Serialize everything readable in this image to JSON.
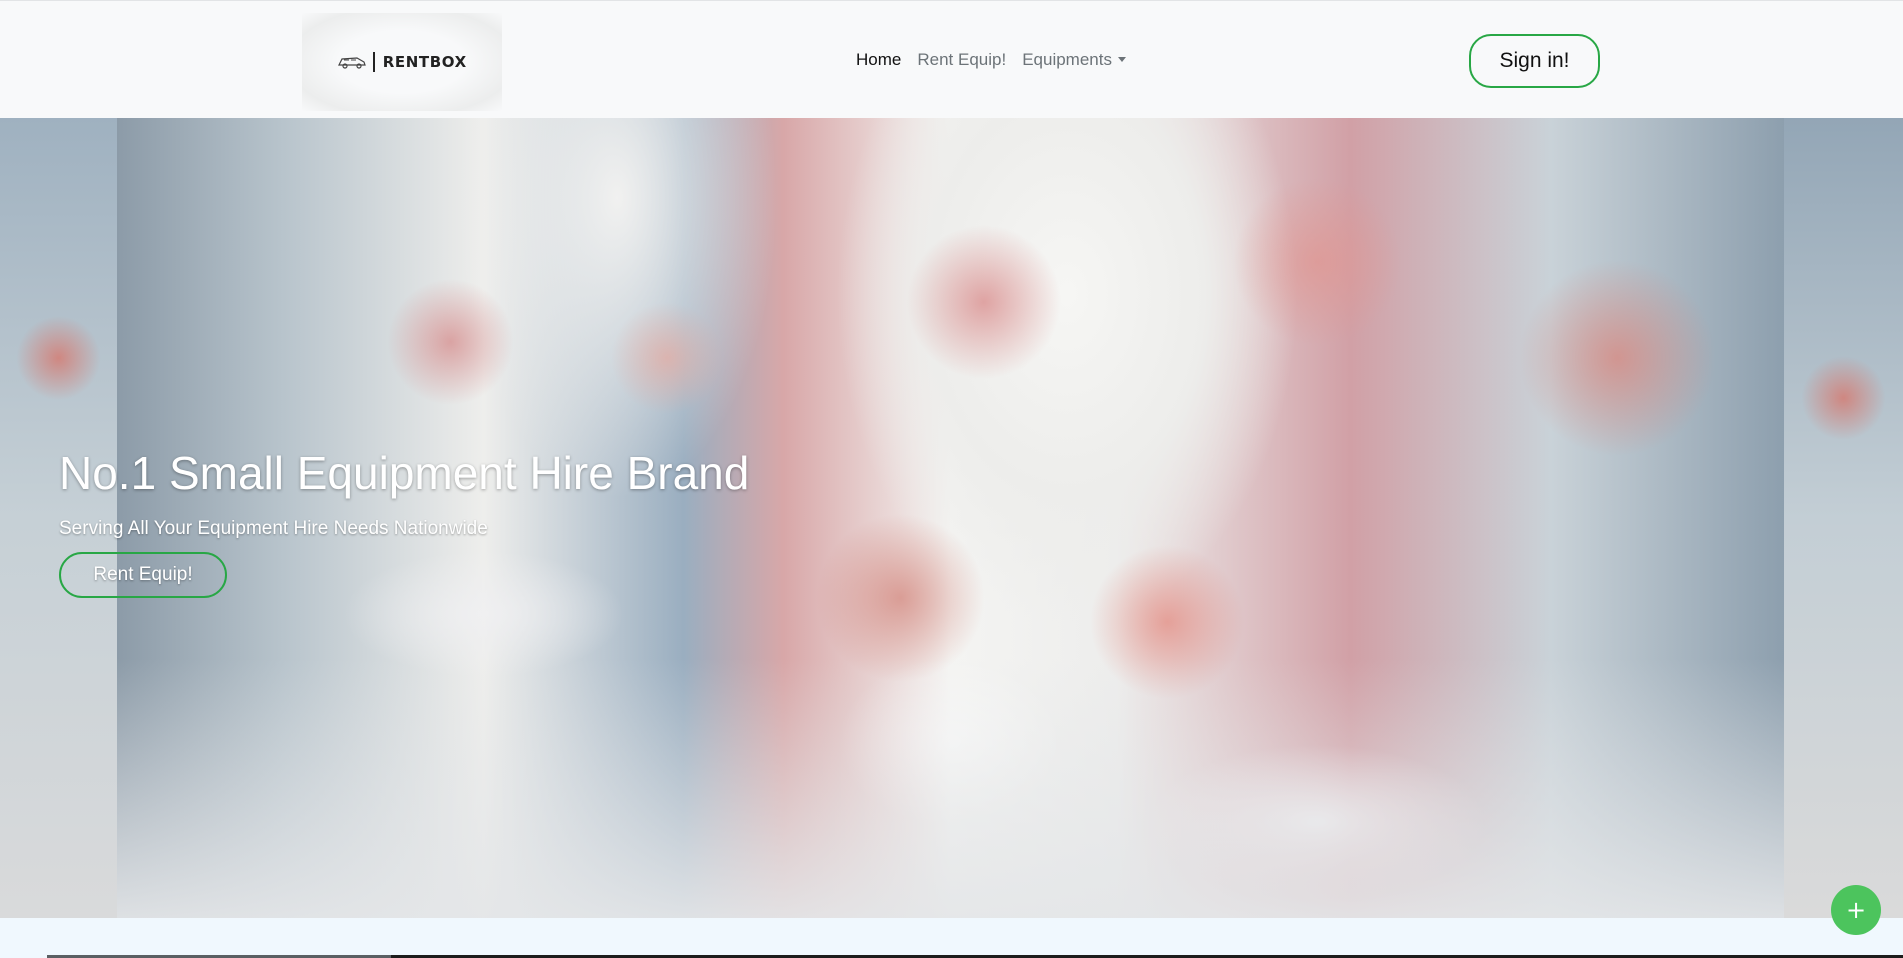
{
  "brand": {
    "name": "RENTBOX",
    "logo_icon": "car-outline-icon"
  },
  "nav": {
    "home": "Home",
    "rent_equip": "Rent Equip!",
    "equipments": "Equipments",
    "signin": "Sign in!"
  },
  "hero": {
    "title": "No.1 Small Equipment Hire Brand",
    "subtitle": "Serving All Your Equipment Hire Needs Nationwide",
    "cta": "Rent Equip!"
  },
  "fab": {
    "label": "+",
    "icon": "plus-icon"
  },
  "colors": {
    "accent_green": "#28a745",
    "fab_green": "#4cc45d",
    "navbar_bg": "#f8f9fa",
    "page_bg": "#f0f8fe"
  }
}
